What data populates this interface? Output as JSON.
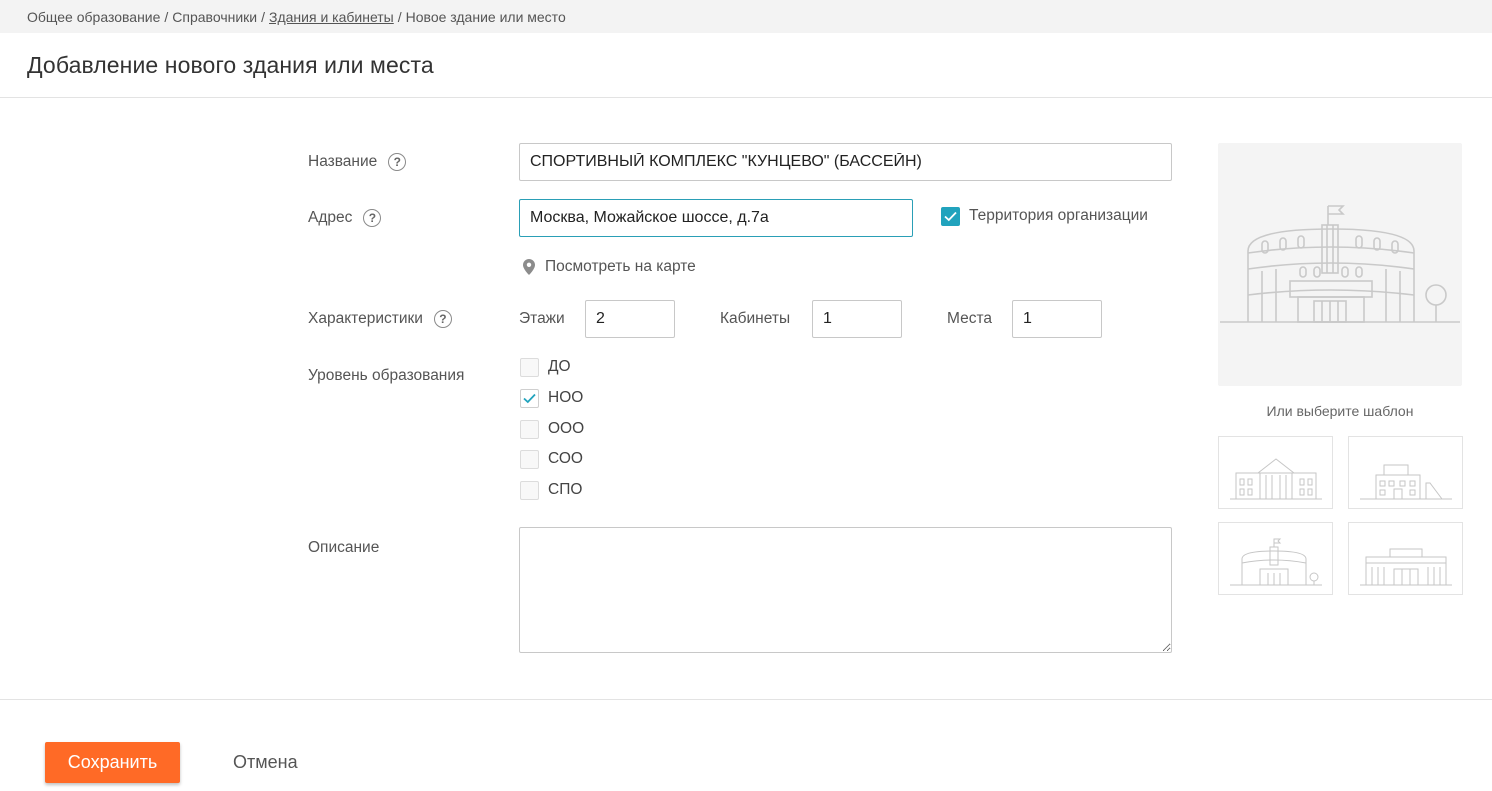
{
  "breadcrumb": {
    "items": [
      "Общее образование",
      "Справочники",
      "Здания и кабинеты",
      "Новое здание или место"
    ],
    "separator": "/"
  },
  "page": {
    "title": "Добавление нового здания или места"
  },
  "form": {
    "name": {
      "label": "Название",
      "value": "СПОРТИВНЫЙ КОМПЛЕКС \"КУНЦЕВО\" (БАССЕЙН)"
    },
    "address": {
      "label": "Адрес",
      "value": "Москва, Можайское шоссе, д.7а",
      "territory_label": "Территория организации",
      "territory_checked": true,
      "map_link": "Посмотреть на карте"
    },
    "characteristics": {
      "label": "Характеристики",
      "floors_label": "Этажи",
      "floors_value": "2",
      "rooms_label": "Кабинеты",
      "rooms_value": "1",
      "places_label": "Места",
      "places_value": "1"
    },
    "education_level": {
      "label": "Уровень образования",
      "options": [
        {
          "label": "ДО",
          "checked": false
        },
        {
          "label": "НОО",
          "checked": true
        },
        {
          "label": "ООО",
          "checked": false
        },
        {
          "label": "СОО",
          "checked": false
        },
        {
          "label": "СПО",
          "checked": false
        }
      ]
    },
    "description": {
      "label": "Описание",
      "value": ""
    }
  },
  "help_glyph": "?",
  "templates": {
    "caption": "Или выберите шаблон"
  },
  "actions": {
    "save_label": "Сохранить",
    "cancel_label": "Отмена"
  },
  "colors": {
    "accent_orange": "#ff6a26",
    "checkbox_teal": "#21a3bd",
    "focus_border": "#2a9fb6",
    "breadcrumb_bg": "#f3f3f3"
  }
}
